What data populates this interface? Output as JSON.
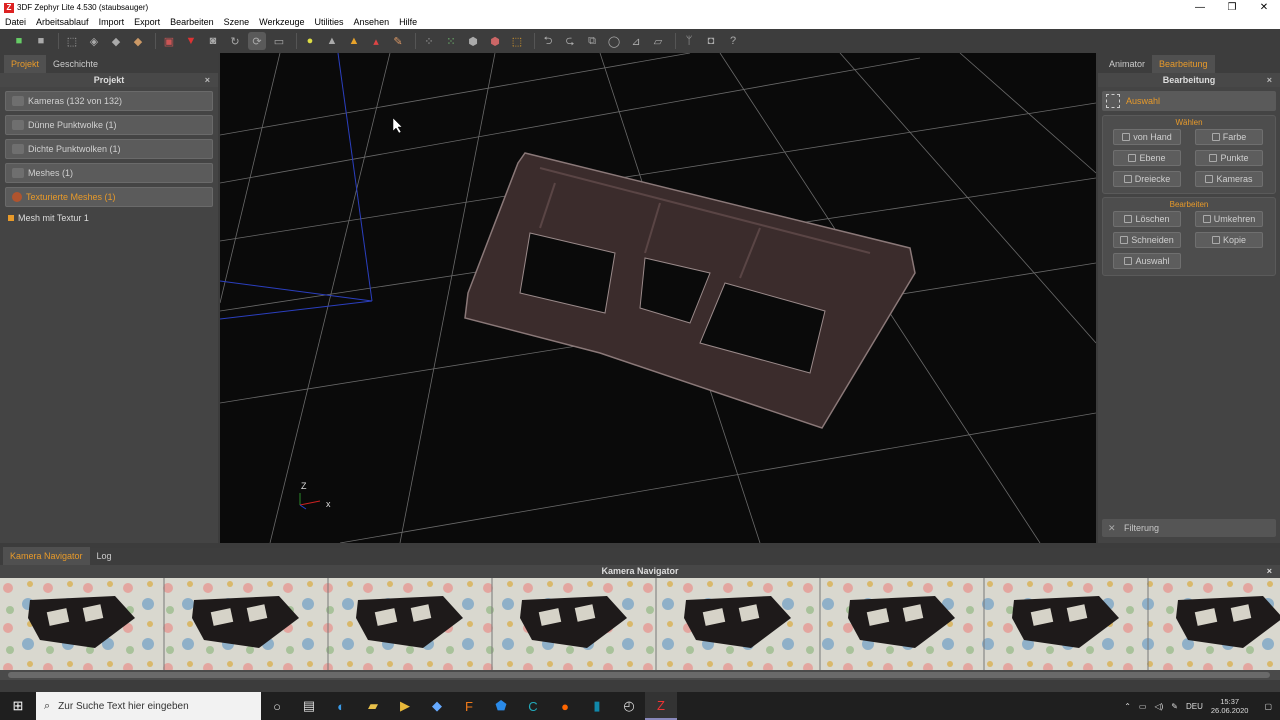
{
  "window": {
    "title": "3DF Zephyr Lite 4.530 (staubsauger)",
    "app_icon": "Z",
    "minimize": "—",
    "restore": "❐",
    "close": "✕"
  },
  "menu": [
    "Datei",
    "Arbeitsablauf",
    "Import",
    "Export",
    "Bearbeiten",
    "Szene",
    "Werkzeuge",
    "Utilities",
    "Ansehen",
    "Hilfe"
  ],
  "left_panel": {
    "tabs": [
      "Projekt",
      "Geschichte"
    ],
    "title": "Projekt",
    "close": "×",
    "rows": [
      "Kameras (132  von  132)",
      "Dünne Punktwolke (1)",
      "Dichte Punktwolken (1)",
      "Meshes (1)",
      "Texturierte Meshes (1)"
    ],
    "mesh_item": "Mesh mit Textur 1"
  },
  "viewport": {
    "axis_z": "Z",
    "axis_x": "x"
  },
  "right_panel": {
    "tabs": [
      "Animator",
      "Bearbeitung"
    ],
    "title": "Bearbeitung",
    "close": "×",
    "auswahl": "Auswahl",
    "waehlen_title": "Wählen",
    "waehlen_buttons": [
      "von Hand",
      "Farbe",
      "Ebene",
      "Punkte",
      "Dreiecke",
      "Kameras"
    ],
    "bearbeiten_title": "Bearbeiten",
    "bearbeiten_buttons": [
      "Löschen",
      "Umkehren",
      "Schneiden",
      "Kopie",
      "Auswahl"
    ],
    "filter": "Filterung"
  },
  "bottom": {
    "tabs": [
      "Kamera Navigator",
      "Log"
    ],
    "title": "Kamera Navigator",
    "close": "×"
  },
  "taskbar": {
    "search_placeholder": "Zur Suche Text hier eingeben",
    "lang": "DEU",
    "time": "15:37",
    "date": "26.06.2020"
  },
  "colors": {
    "accent": "#e89a2a",
    "panel": "#444444",
    "viewport": "#0a0a0a"
  }
}
